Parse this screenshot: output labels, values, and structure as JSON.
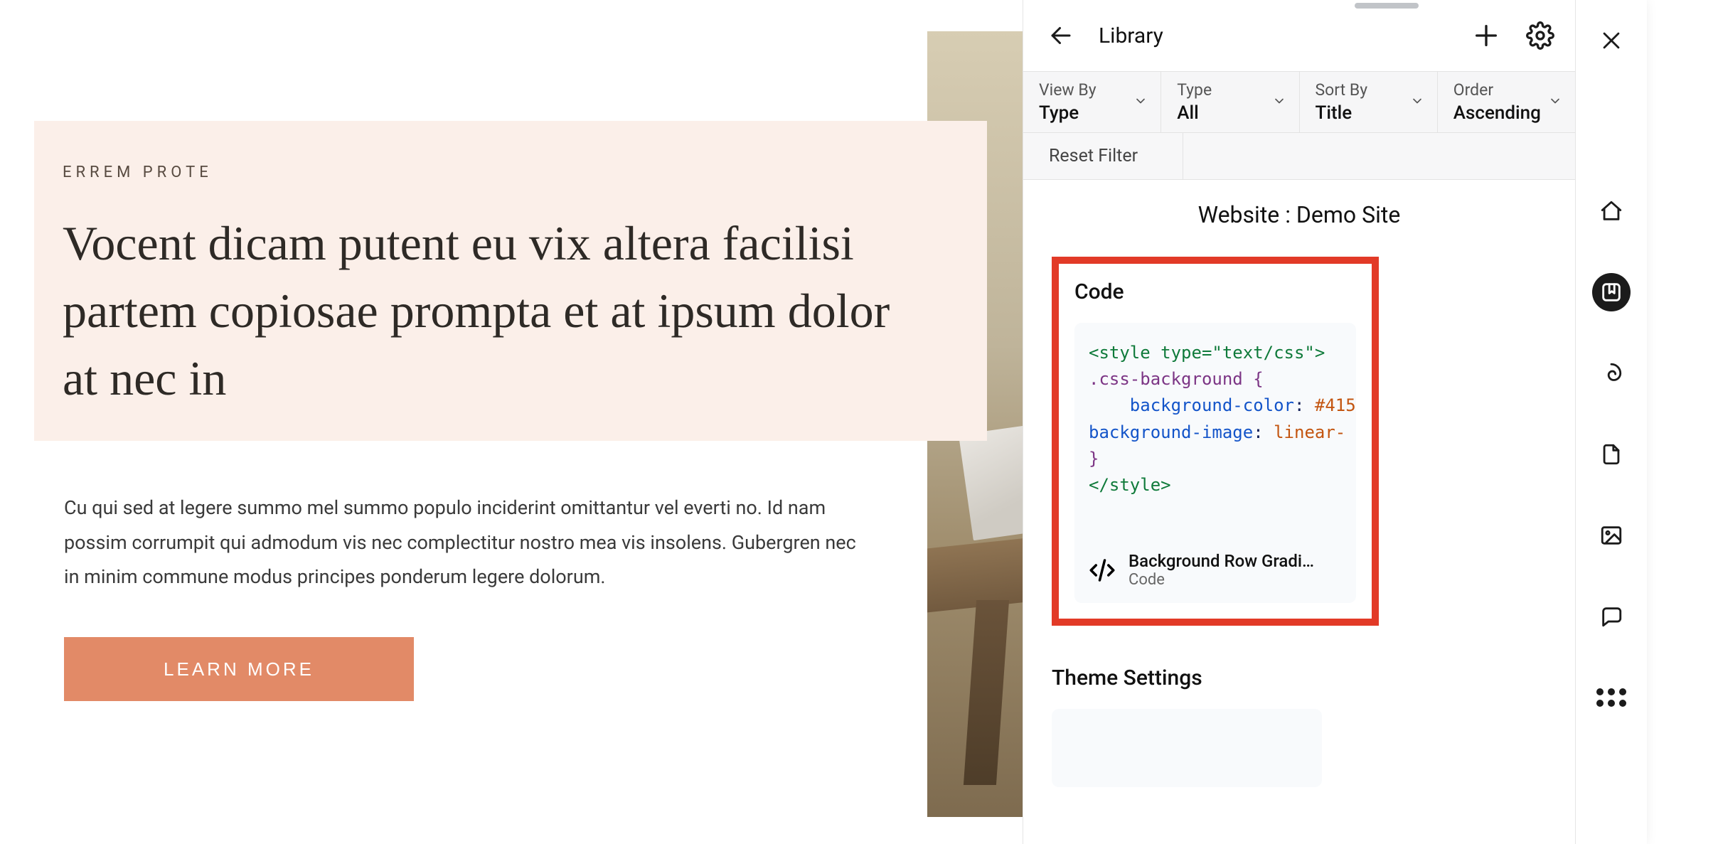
{
  "preview": {
    "eyebrow": "ERREM PROTE",
    "headline": "Vocent dicam putent eu vix altera facilisi partem copiosae prompta et at ipsum dolor at nec in",
    "body": "Cu qui sed at legere summo mel summo populo inciderint omittantur vel everti no. Id nam possim corrumpit qui admodum vis nec complectitur nostro mea vis insolens. Gubergren nec in minim commune modus principes ponderum legere dolorum.",
    "cta_label": "LEARN MORE"
  },
  "panel": {
    "title": "Library",
    "filters": {
      "view_by": {
        "label": "View By",
        "value": "Type"
      },
      "type": {
        "label": "Type",
        "value": "All"
      },
      "sort_by": {
        "label": "Sort By",
        "value": "Title"
      },
      "order": {
        "label": "Order",
        "value": "Ascending"
      }
    },
    "reset_label": "Reset Filter",
    "site_line": "Website : Demo Site",
    "sections": {
      "code_title": "Code",
      "code_block": {
        "line1": "<style type=\"text/css\">",
        "line2_sel": ".css-background",
        "line2_brace": " {",
        "line3_prop": "background-color",
        "line3_punc1": ": ",
        "line3_val": "#415",
        "line4_prop": "background-image",
        "line4_punc1": ": ",
        "line4_val": "linear-",
        "line5": "}",
        "line6": "</style>"
      },
      "code_meta_title": "Background Row Gradi…",
      "code_meta_sub": "Code",
      "theme_title": "Theme Settings"
    }
  },
  "colors": {
    "hero_bg": "#fbefe9",
    "cta_bg": "#e28a67",
    "highlight_border": "#e23a27"
  }
}
